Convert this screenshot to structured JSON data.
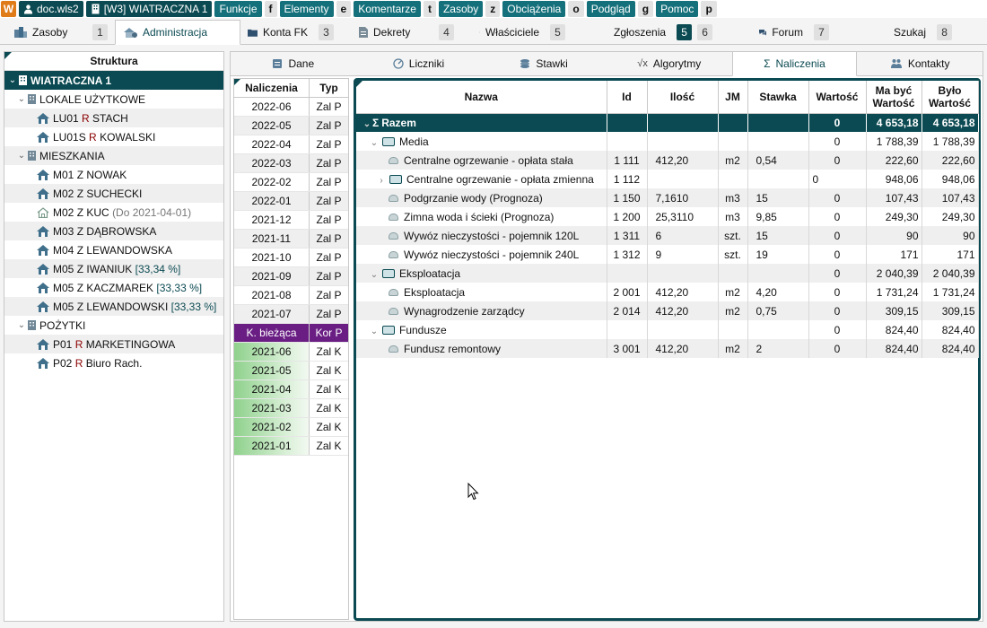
{
  "topbar": {
    "logo": "W",
    "doc": "doc.wls2",
    "window": "[W3] WIATRACZNA 1",
    "menus": [
      {
        "label": "Funkcje",
        "key": "f"
      },
      {
        "label": "Elementy",
        "key": "e"
      },
      {
        "label": "Komentarze",
        "key": "t"
      },
      {
        "label": "Zasoby",
        "key": "z"
      },
      {
        "label": "Obciążenia",
        "key": "o"
      },
      {
        "label": "Podgląd",
        "key": "g"
      },
      {
        "label": "Pomoc",
        "key": "p"
      }
    ]
  },
  "main_tabs": [
    {
      "label": "Zasoby",
      "num": "1",
      "icon": "buildings-icon"
    },
    {
      "label": "Administracja",
      "num": "",
      "icon": "admin-house-icon"
    },
    {
      "label": "Konta FK",
      "num": "3",
      "icon": "folder-icon"
    },
    {
      "label": "Dekrety",
      "num": "4",
      "icon": "document-icon"
    },
    {
      "label": "Właściciele",
      "num": "5",
      "icon": "people-icon"
    },
    {
      "label": "Zgłoszenia",
      "num": "6",
      "badge": "5",
      "icon": "question-icon"
    },
    {
      "label": "Forum",
      "num": "7",
      "icon": "chat-icon"
    },
    {
      "label": "Szukaj",
      "num": "8",
      "icon": "search-icon"
    }
  ],
  "structure": {
    "title": "Struktura",
    "root": "WIATRACZNA 1",
    "groups": [
      {
        "label": "LOKALE UŻYTKOWE",
        "items": [
          {
            "code": "LU01",
            "role": "R",
            "name": "STACH",
            "note": ""
          },
          {
            "code": "LU01S",
            "role": "R",
            "name": "KOWALSKI",
            "note": ""
          }
        ]
      },
      {
        "label": "MIESZKANIA",
        "items": [
          {
            "code": "M01",
            "role": "Z",
            "name": "NOWAK",
            "note": ""
          },
          {
            "code": "M02",
            "role": "Z",
            "name": "SUCHECKI",
            "note": ""
          },
          {
            "code": "M02",
            "role": "Z",
            "name": "KUC",
            "note": "(Do 2021-04-01)"
          },
          {
            "code": "M03",
            "role": "Z",
            "name": "DĄBROWSKA",
            "note": ""
          },
          {
            "code": "M04",
            "role": "Z",
            "name": "LEWANDOWSKA",
            "note": ""
          },
          {
            "code": "M05",
            "role": "Z",
            "name": "IWANIUK",
            "note": "[33,34 %]"
          },
          {
            "code": "M05",
            "role": "Z",
            "name": "KACZMAREK",
            "note": "[33,33 %]"
          },
          {
            "code": "M05",
            "role": "Z",
            "name": "LEWANDOWSKI",
            "note": "[33,33 %]"
          }
        ]
      },
      {
        "label": "POŻYTKI",
        "items": [
          {
            "code": "P01",
            "role": "R",
            "name": "MARKETINGOWA",
            "note": ""
          },
          {
            "code": "P02",
            "role": "R",
            "name": "Biuro Rach.",
            "note": ""
          }
        ]
      }
    ]
  },
  "sub_tabs": [
    {
      "label": "Dane",
      "icon": "data-icon"
    },
    {
      "label": "Liczniki",
      "icon": "meter-icon"
    },
    {
      "label": "Stawki",
      "icon": "coins-icon"
    },
    {
      "label": "Algorytmy",
      "icon": "sqrt-icon"
    },
    {
      "label": "Naliczenia",
      "icon": "sigma-icon"
    },
    {
      "label": "Kontakty",
      "icon": "contacts-icon"
    }
  ],
  "periods": {
    "headers": [
      "Naliczenia",
      "Typ"
    ],
    "rows_p": [
      [
        "2022-06",
        "Zal P"
      ],
      [
        "2022-05",
        "Zal P"
      ],
      [
        "2022-04",
        "Zal P"
      ],
      [
        "2022-03",
        "Zal P"
      ],
      [
        "2022-02",
        "Zal P"
      ],
      [
        "2022-01",
        "Zal P"
      ],
      [
        "2021-12",
        "Zal P"
      ],
      [
        "2021-11",
        "Zal P"
      ],
      [
        "2021-10",
        "Zal P"
      ],
      [
        "2021-09",
        "Zal P"
      ],
      [
        "2021-08",
        "Zal P"
      ],
      [
        "2021-07",
        "Zal P"
      ]
    ],
    "current": [
      "K. bieżąca",
      "Kor P"
    ],
    "rows_k": [
      [
        "2021-06",
        "Zal K"
      ],
      [
        "2021-05",
        "Zal K"
      ],
      [
        "2021-04",
        "Zal K"
      ],
      [
        "2021-03",
        "Zal K"
      ],
      [
        "2021-02",
        "Zal K"
      ],
      [
        "2021-01",
        "Zal K"
      ]
    ]
  },
  "grid": {
    "headers": {
      "nazwa": "Nazwa",
      "id": "Id",
      "ilosc": "Ilość",
      "jm": "JM",
      "stawka": "Stawka",
      "wartosc": "Wartość",
      "ma_byc_1": "Ma być",
      "ma_byc_2": "Wartość",
      "bylo_1": "Było",
      "bylo_2": "Wartość"
    },
    "rows": [
      {
        "kind": "sum",
        "name": "Razem",
        "id": "",
        "ilosc": "",
        "jm": "",
        "stawka": "",
        "wartosc": "0",
        "ma_byc": "4 653,18",
        "bylo": "4 653,18"
      },
      {
        "kind": "group",
        "name": "Media",
        "id": "",
        "ilosc": "",
        "jm": "",
        "stawka": "",
        "wartosc": "0",
        "ma_byc": "1 788,39",
        "bylo": "1 788,39"
      },
      {
        "kind": "item",
        "name": "Centralne ogrzewanie - opłata stała",
        "id": "1 111",
        "ilosc": "412,20",
        "jm": "m2",
        "stawka": "0,54",
        "wartosc": "0",
        "ma_byc": "222,60",
        "bylo": "222,60"
      },
      {
        "kind": "subgroup",
        "name": "Centralne ogrzewanie - opłata zmienna",
        "id": "1 112",
        "ilosc": "",
        "jm": "",
        "stawka": "",
        "wartosc": "0",
        "ma_byc": "948,06",
        "bylo": "948,06"
      },
      {
        "kind": "item",
        "name": "Podgrzanie wody (Prognoza)",
        "id": "1 150",
        "ilosc": "7,1610",
        "jm": "m3",
        "stawka": "15",
        "wartosc": "0",
        "ma_byc": "107,43",
        "bylo": "107,43"
      },
      {
        "kind": "item",
        "name": "Zimna woda i ścieki (Prognoza)",
        "id": "1 200",
        "ilosc": "25,3110",
        "jm": "m3",
        "stawka": "9,85",
        "wartosc": "0",
        "ma_byc": "249,30",
        "bylo": "249,30"
      },
      {
        "kind": "item",
        "name": "Wywóz nieczystości - pojemnik 120L",
        "id": "1 311",
        "ilosc": "6",
        "jm": "szt.",
        "stawka": "15",
        "wartosc": "0",
        "ma_byc": "90",
        "bylo": "90"
      },
      {
        "kind": "item",
        "name": "Wywóz nieczystości - pojemnik 240L",
        "id": "1 312",
        "ilosc": "9",
        "jm": "szt.",
        "stawka": "19",
        "wartosc": "0",
        "ma_byc": "171",
        "bylo": "171"
      },
      {
        "kind": "group",
        "name": "Eksploatacja",
        "id": "",
        "ilosc": "",
        "jm": "",
        "stawka": "",
        "wartosc": "0",
        "ma_byc": "2 040,39",
        "bylo": "2 040,39"
      },
      {
        "kind": "item",
        "name": "Eksploatacja",
        "id": "2 001",
        "ilosc": "412,20",
        "jm": "m2",
        "stawka": "4,20",
        "wartosc": "0",
        "ma_byc": "1 731,24",
        "bylo": "1 731,24"
      },
      {
        "kind": "item",
        "name": "Wynagrodzenie zarządcy",
        "id": "2 014",
        "ilosc": "412,20",
        "jm": "m2",
        "stawka": "0,75",
        "wartosc": "0",
        "ma_byc": "309,15",
        "bylo": "309,15"
      },
      {
        "kind": "group",
        "name": "Fundusze",
        "id": "",
        "ilosc": "",
        "jm": "",
        "stawka": "",
        "wartosc": "0",
        "ma_byc": "824,40",
        "bylo": "824,40"
      },
      {
        "kind": "item",
        "name": "Fundusz remontowy",
        "id": "3 001",
        "ilosc": "412,20",
        "jm": "m2",
        "stawka": "2",
        "wartosc": "0",
        "ma_byc": "824,40",
        "bylo": "824,40"
      }
    ]
  },
  "colors": {
    "primary": "#0b4a52",
    "accent": "#14707b",
    "current_period": "#6a1e84",
    "correction_green": "#8fd18c",
    "owner_letter": "#8b0000",
    "logo": "#e07b1a"
  }
}
